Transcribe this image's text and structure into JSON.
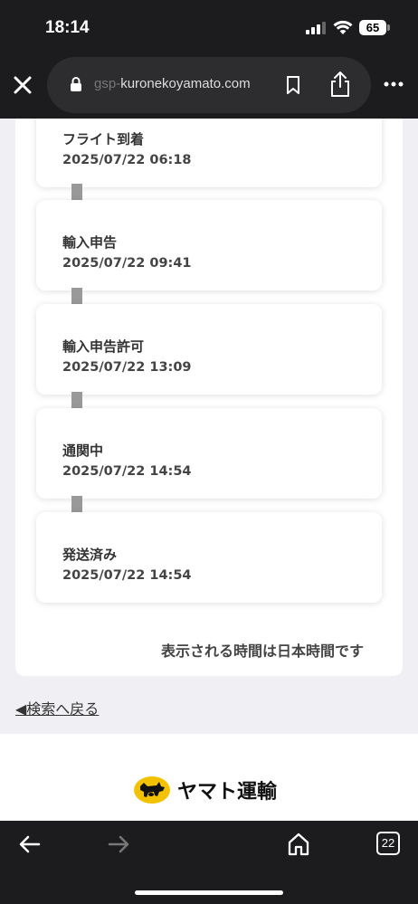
{
  "status_bar": {
    "time": "18:14",
    "battery": "65"
  },
  "browser": {
    "url_prefix": "gsp-",
    "url_rest": "kuronekoyamato.com"
  },
  "events": [
    {
      "label": "フライト到着",
      "date": "2025/07/22 06:18"
    },
    {
      "label": "輸入申告",
      "date": "2025/07/22 09:41"
    },
    {
      "label": "輸入申告許可",
      "date": "2025/07/22 13:09"
    },
    {
      "label": "通関中",
      "date": "2025/07/22 14:54"
    },
    {
      "label": "発送済み",
      "date": "2025/07/22 14:54"
    }
  ],
  "note": "表示される時間は日本時間です",
  "back_link": "◀検索へ戻る",
  "footer": {
    "logo_text": "ヤマト運輸"
  },
  "toolbar": {
    "tab_count": "22"
  },
  "colors": {
    "chrome": "#1c1c1e",
    "page_bg": "#efeff4",
    "connector": "#999999",
    "logo_yellow": "#f2c200"
  }
}
